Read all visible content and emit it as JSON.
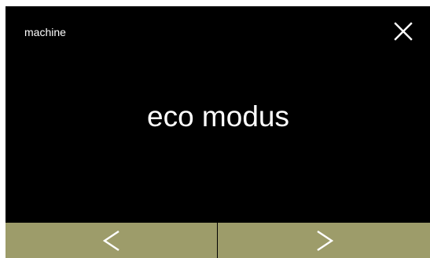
{
  "header": {
    "title": "machine",
    "close_icon": "close-icon"
  },
  "main": {
    "label": "eco modus"
  },
  "footer": {
    "background_color": "#9d9c6a",
    "prev_icon": "chevron-left-icon",
    "next_icon": "chevron-right-icon"
  },
  "colors": {
    "screen_background": "#000000",
    "text": "#ffffff",
    "footer": "#9d9c6a"
  }
}
